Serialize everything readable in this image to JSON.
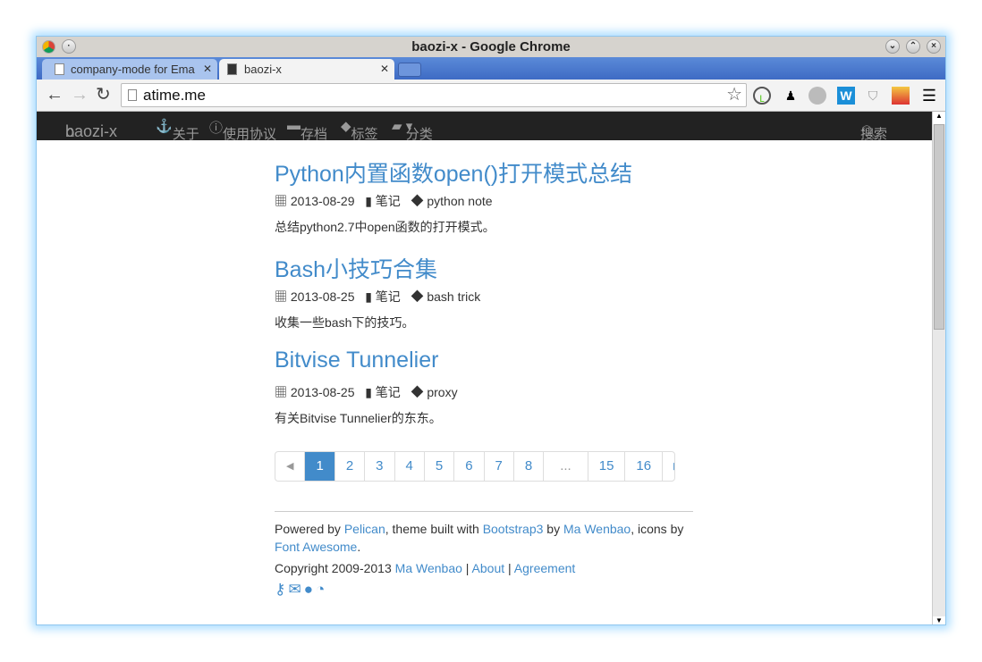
{
  "window": {
    "title": "baozi-x - Google Chrome"
  },
  "tabs": [
    {
      "label": "company-mode for Ema"
    },
    {
      "label": "baozi-x"
    }
  ],
  "toolbar": {
    "url": "atime.me"
  },
  "navbar": {
    "brand": "baozi-x",
    "items": [
      "关于",
      "使用协议",
      "存档",
      "标签",
      "分类"
    ],
    "search": "搜索"
  },
  "posts": [
    {
      "title": "Python内置函数open()打开模式总结",
      "date": "2013-08-29",
      "category": "笔记",
      "tags": "python note",
      "summary": "总结python2.7中open函数的打开模式。"
    },
    {
      "title": "Bash小技巧合集",
      "date": "2013-08-25",
      "category": "笔记",
      "tags": "bash trick",
      "summary": "收集一些bash下的技巧。"
    },
    {
      "title": "Bitvise Tunnelier",
      "date": "2013-08-25",
      "category": "笔记",
      "tags": "proxy",
      "summary": "有关Bitvise Tunnelier的东东。"
    }
  ],
  "pagination": {
    "pages": [
      "1",
      "2",
      "3",
      "4",
      "5",
      "6",
      "7",
      "8",
      "...",
      "15",
      "16"
    ],
    "current": "1"
  },
  "footer": {
    "powered_by": "Powered by ",
    "pelican": "Pelican",
    "theme": ", theme built with ",
    "bootstrap": "Bootstrap3",
    "by": " by ",
    "author": "Ma Wenbao",
    "icons_by": ", icons by ",
    "fa": "Font Awesome",
    "dot": ".",
    "copyright": "Copyright 2009-2013 ",
    "sep": " | ",
    "about": "About",
    "agreement": "Agreement"
  },
  "colors": {
    "accent": "#428bca",
    "navbar": "#222222"
  }
}
